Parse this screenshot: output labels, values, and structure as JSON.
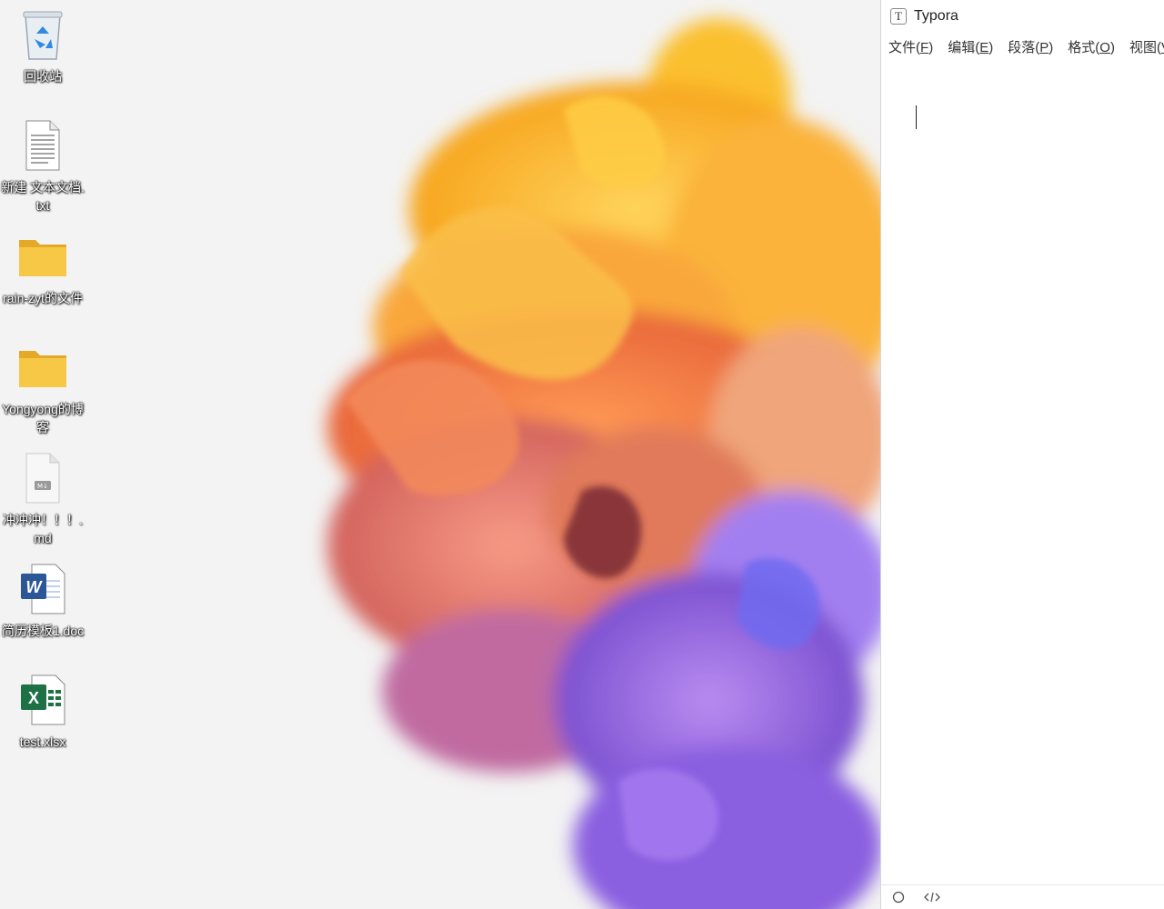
{
  "desktop": {
    "icons": [
      {
        "label": "回收站",
        "icon": "recycle-bin-icon"
      },
      {
        "label": "新建 文本文档.txt",
        "icon": "text-file-icon"
      },
      {
        "label": "rain-zyt的文件",
        "icon": "folder-icon"
      },
      {
        "label": "Yongyong的博客",
        "icon": "folder-icon"
      },
      {
        "label": "冲冲冲！！！.md",
        "icon": "markdown-file-icon"
      },
      {
        "label": "简历模板1.doc",
        "icon": "word-doc-icon"
      },
      {
        "label": "test.xlsx",
        "icon": "excel-file-icon"
      }
    ]
  },
  "typora": {
    "title": "Typora",
    "logo_letter": "T",
    "menu": [
      {
        "label": "文件",
        "key": "F"
      },
      {
        "label": "编辑",
        "key": "E"
      },
      {
        "label": "段落",
        "key": "P"
      },
      {
        "label": "格式",
        "key": "O"
      },
      {
        "label": "视图",
        "key": "V"
      }
    ],
    "status_icons": [
      "circle-outline-icon",
      "source-code-icon"
    ]
  },
  "colors": {
    "accent_folder": "#f6c846",
    "word_blue": "#2b5797",
    "excel_green": "#1e7145"
  }
}
